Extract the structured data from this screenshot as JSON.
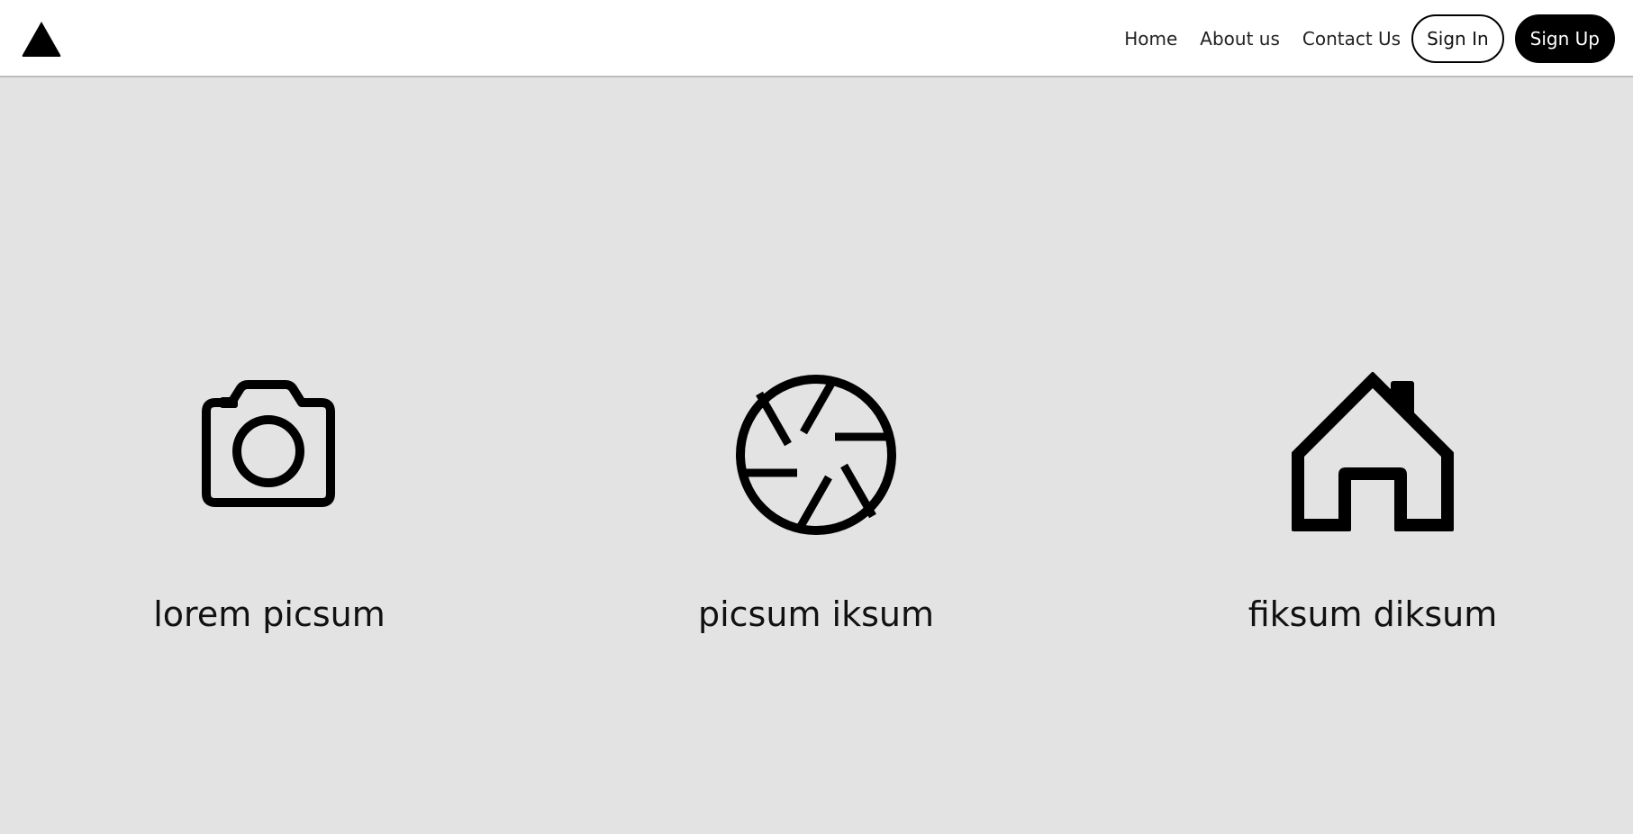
{
  "brand": {
    "logo_icon": "triangle-logo-icon"
  },
  "nav": {
    "links": [
      {
        "label": "Home"
      },
      {
        "label": "About us"
      },
      {
        "label": "Contact Us"
      }
    ],
    "sign_in_label": "Sign In",
    "sign_up_label": "Sign Up"
  },
  "features": [
    {
      "icon": "camera-icon",
      "label": "lorem picsum"
    },
    {
      "icon": "aperture-icon",
      "label": "picsum iksum"
    },
    {
      "icon": "house-icon",
      "label": "fiksum diksum"
    }
  ],
  "colors": {
    "background": "#e3e3e3",
    "navbar": "#ffffff",
    "accent": "#000000"
  }
}
